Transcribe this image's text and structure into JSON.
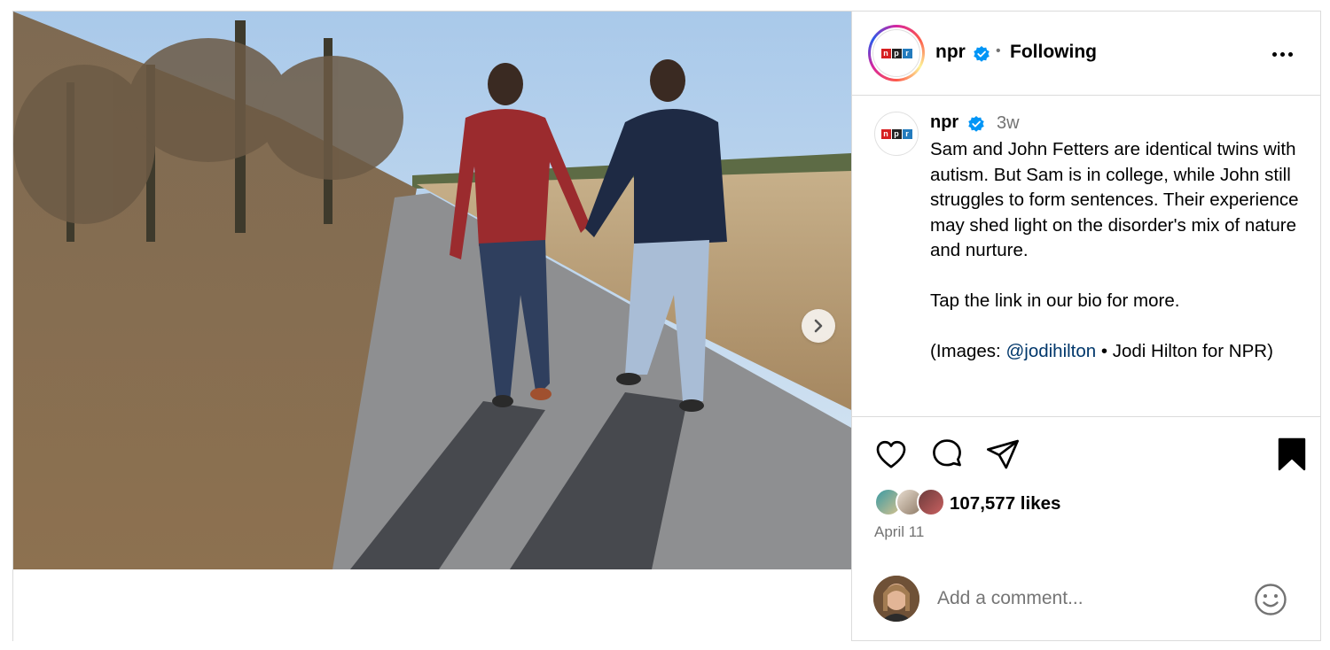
{
  "post": {
    "account": {
      "username": "npr",
      "follow_status": "Following",
      "separator": "•",
      "logo_letters": [
        "n",
        "p",
        "r"
      ]
    },
    "caption": {
      "username": "npr",
      "time_ago": "3w",
      "paragraph1": "Sam and John Fetters are identical twins with autism. But Sam is in college, while John still struggles to form sentences. Their experience may shed light on the disorder's mix of nature and nurture.",
      "paragraph2": "Tap the link in our bio for more.",
      "credit_prefix": "(Images: ",
      "credit_mention": "@jodihilton",
      "credit_suffix": " • Jodi Hilton for NPR)"
    },
    "actions": {
      "like_icon": "heart-icon",
      "comment_icon": "comment-icon",
      "share_icon": "paper-plane-icon",
      "save_icon": "bookmark-filled-icon"
    },
    "likes": {
      "count_text": "107,577 likes"
    },
    "date": "April 11",
    "comment": {
      "placeholder": "Add a comment..."
    },
    "colors": {
      "verified": "#0095f6",
      "mention": "#00376b",
      "muted": "#737373",
      "border": "#dbdbdb"
    }
  }
}
